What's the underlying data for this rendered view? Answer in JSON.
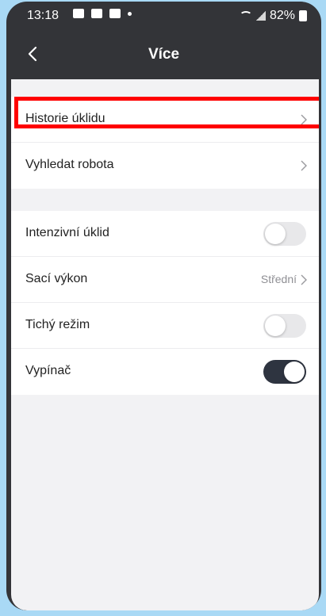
{
  "status_bar": {
    "time": "13:18",
    "battery": "82%"
  },
  "header": {
    "title": "Více"
  },
  "section1": {
    "items": [
      {
        "label": "Historie úklidu"
      },
      {
        "label": "Vyhledat robota"
      }
    ]
  },
  "section2": {
    "intensive_cleaning": {
      "label": "Intenzivní úklid",
      "toggle_on": false
    },
    "suction_power": {
      "label": "Sací výkon",
      "value": "Střední"
    },
    "quiet_mode": {
      "label": "Tichý režim",
      "toggle_on": false
    },
    "switch": {
      "label": "Vypínač",
      "toggle_on": true
    }
  },
  "colors": {
    "background": "#a9d9f5",
    "header": "#333438",
    "toggle_on": "#2e3440",
    "toggle_off": "#e8e8ea",
    "highlight": "#ff0000"
  }
}
